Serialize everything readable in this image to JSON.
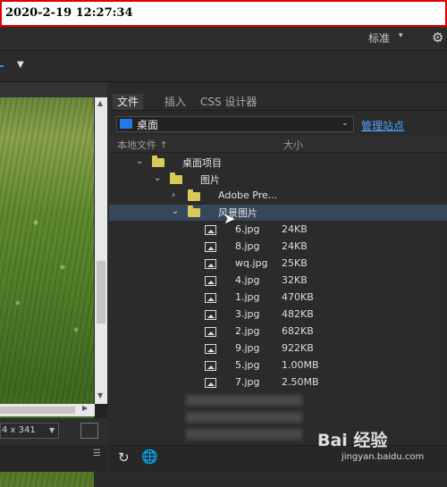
{
  "timestamp": "2020-2-19 12:27:34",
  "topbar": {
    "workspace_label": "标准",
    "workspace_caret_icon": "chevron-down-icon",
    "settings_icon": "gear-icon"
  },
  "left_panel": {
    "dimensions_label": "4 x 341"
  },
  "files_panel": {
    "tabs": [
      {
        "label": "文件",
        "active": true
      },
      {
        "label": "插入",
        "active": false
      },
      {
        "label": "CSS 设计器",
        "active": false
      }
    ],
    "site": {
      "selected": "桌面",
      "manage_link": "管理站点"
    },
    "columns": {
      "name": "本地文件",
      "size": "大小"
    },
    "tree": [
      {
        "name": "桌面项目",
        "type": "folder",
        "level": 1,
        "expanded": true
      },
      {
        "name": "图片",
        "type": "folder",
        "level": 2,
        "expanded": true
      },
      {
        "name": "Adobe Pre...",
        "type": "folder",
        "level": 3,
        "expanded": false
      },
      {
        "name": "风景图片",
        "type": "folder",
        "level": 3,
        "expanded": true,
        "selected": true
      },
      {
        "name": "6.jpg",
        "type": "image",
        "size": "24KB"
      },
      {
        "name": "8.jpg",
        "type": "image",
        "size": "24KB"
      },
      {
        "name": "wq.jpg",
        "type": "image",
        "size": "25KB"
      },
      {
        "name": "4.jpg",
        "type": "image",
        "size": "32KB"
      },
      {
        "name": "1.jpg",
        "type": "image",
        "size": "470KB"
      },
      {
        "name": "3.jpg",
        "type": "image",
        "size": "482KB"
      },
      {
        "name": "2.jpg",
        "type": "image",
        "size": "682KB"
      },
      {
        "name": "9.jpg",
        "type": "image",
        "size": "922KB"
      },
      {
        "name": "5.jpg",
        "type": "image",
        "size": "1.00MB"
      },
      {
        "name": "7.jpg",
        "type": "image",
        "size": "2.50MB"
      }
    ],
    "bottom_icons": [
      "refresh-icon",
      "globe-icon"
    ]
  },
  "watermark": {
    "brand": "Bai 经验",
    "url": "jingyan.baidu.com"
  },
  "colors": {
    "accent_link": "#4fa6ff",
    "selection": "#37475a",
    "folder": "#d9c85a",
    "site_icon": "#1e7be8",
    "timestamp_border": "#e00000"
  }
}
